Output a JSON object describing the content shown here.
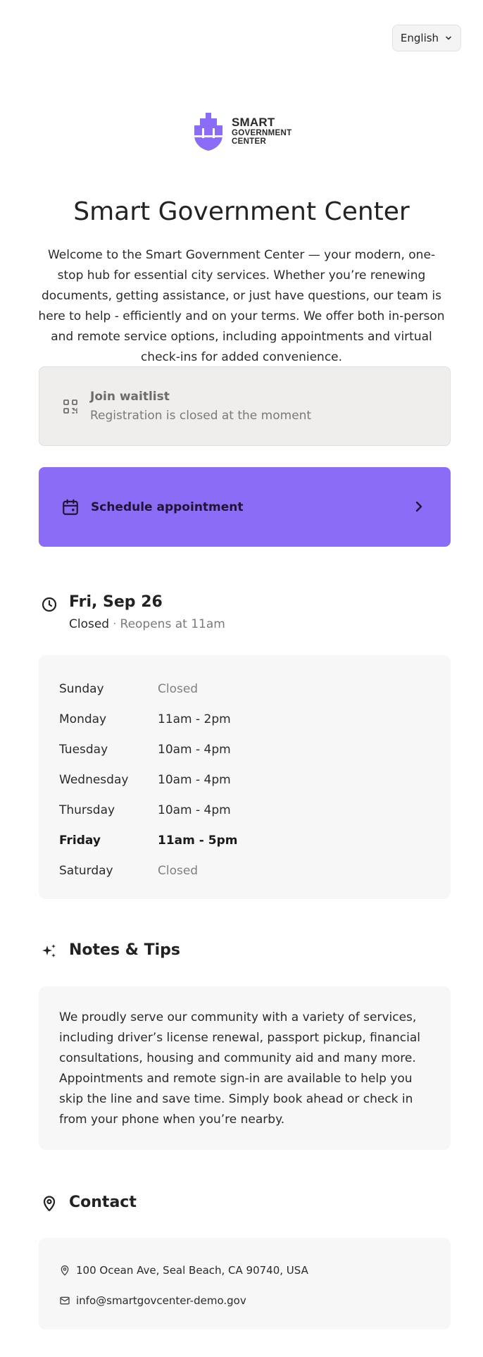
{
  "language": {
    "selected": "English"
  },
  "logo": {
    "line1": "SMART",
    "line2": "GOVERNMENT",
    "line3": "CENTER",
    "color": "#8b6cf6"
  },
  "title": "Smart Government Center",
  "intro": "Welcome to the Smart Government Center — your modern, one-stop hub for essential city services. Whether you’re renewing documents, getting assistance, or just have questions, our team is here to help - efficiently and on your terms. We offer both in-person and remote service options, including appointments and virtual check-ins for added convenience.",
  "waitlist": {
    "icon": "qr-code-icon",
    "title": "Join waitlist",
    "subtitle": "Registration is closed at the moment"
  },
  "schedule": {
    "icon": "calendar-icon",
    "label": "Schedule appointment",
    "accent": "#8b6cf6"
  },
  "hours": {
    "icon": "clock-icon",
    "date": "Fri, Sep 26",
    "status": "Closed",
    "separator": "·",
    "reopens": "Reopens at 11am",
    "rows": [
      {
        "day": "Sunday",
        "time": "Closed"
      },
      {
        "day": "Monday",
        "time": "11am - 2pm"
      },
      {
        "day": "Tuesday",
        "time": "10am - 4pm"
      },
      {
        "day": "Wednesday",
        "time": "10am - 4pm"
      },
      {
        "day": "Thursday",
        "time": "10am - 4pm"
      },
      {
        "day": "Friday",
        "time": "11am - 5pm"
      },
      {
        "day": "Saturday",
        "time": "Closed"
      }
    ]
  },
  "notes": {
    "icon": "sparkles-icon",
    "heading": "Notes & Tips",
    "body": "We proudly serve our community with a variety of services, including driver’s license renewal, passport pickup, financial consultations, housing and community aid and many more. Appointments and remote sign-in are available to help you skip the line and save time. Simply book ahead or check in from your phone when you’re nearby."
  },
  "contact": {
    "icon": "map-pin-icon",
    "heading": "Contact",
    "address": "100 Ocean Ave, Seal Beach, CA 90740, USA",
    "email": "info@smartgovcenter-demo.gov"
  }
}
